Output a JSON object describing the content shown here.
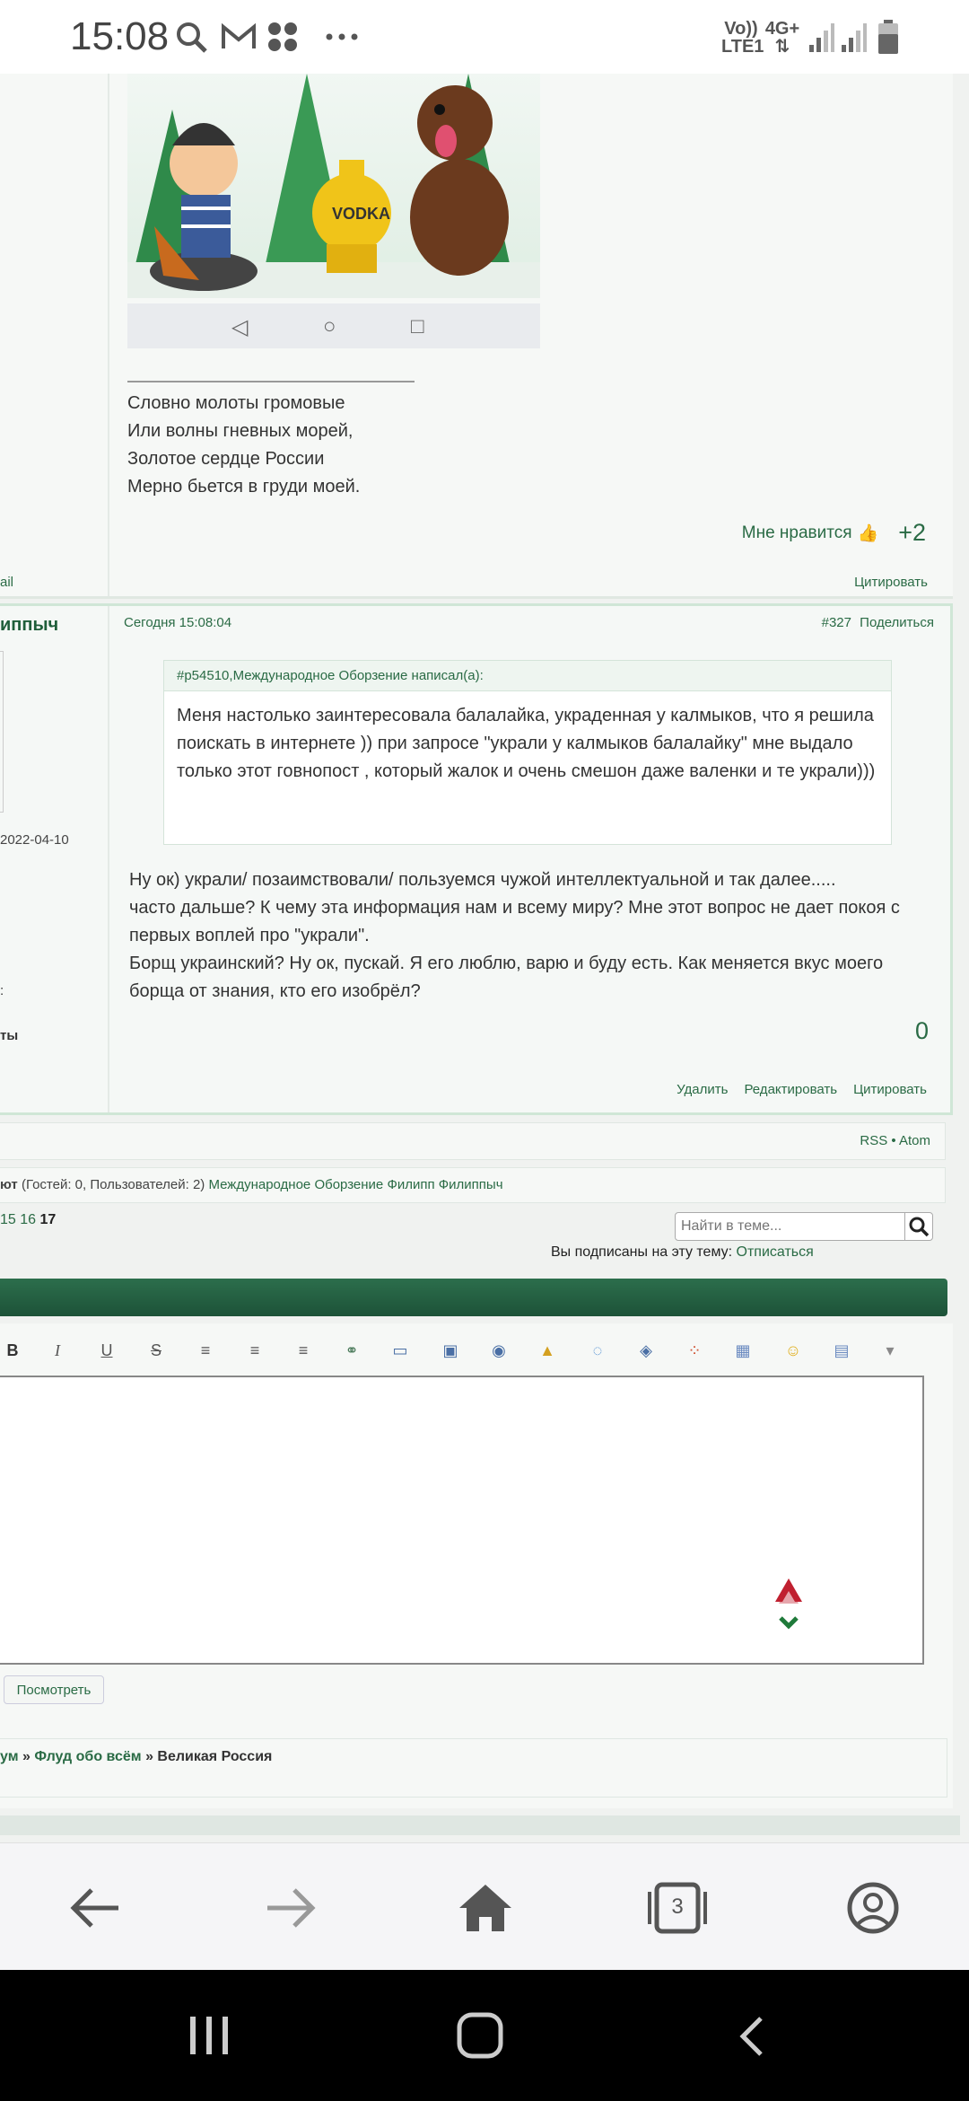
{
  "status_bar": {
    "time": "15:08",
    "volte": "Vo))",
    "lte": "LTE1",
    "network": "4G+"
  },
  "post1": {
    "signature": [
      "Словно молоты громовые",
      "Или волны гневных морей,",
      "Золотое сердце России",
      "Мерно бьется в груди моей."
    ],
    "like_label": "Мне нравится",
    "like_count": "+2",
    "left_link": "ail",
    "quote_link": "Цитировать",
    "meme_text": "VODKA"
  },
  "post2": {
    "author": "иппыч",
    "reg_date": "2022-04-10",
    "side_text_1": ":",
    "side_text_2": "ты",
    "date": "Сегодня 15:08:04",
    "number": "#327",
    "share": "Поделиться",
    "quote_header": "#p54510,Международное Оборзение написал(а):",
    "quote_body": "Меня настолько заинтересовала балалайка, украденная у калмыков, что я решила поискать в интернете )) при запросе \"украли у калмыков балалайку\" мне выдало только этот говнопост , который жалок и очень смешон     даже валенки и те украли)))",
    "text": [
      "Ну ок) украли/ позаимствовали/ пользуемся чужой интеллектуальной и так далее.....",
      "часто дальше? К чему эта информация нам и всему миру? Мне этот вопрос не дает покоя с первых воплей про \"украли\".",
      "Борщ украинский? Ну ок, пускай.  Я его люблю, варю и буду есть. Как меняется вкус моего борща от знания, кто его изобрёл?"
    ],
    "score": "0",
    "actions": [
      "Удалить",
      "Редактировать",
      "Цитировать"
    ]
  },
  "rss": "RSS • Atom",
  "online": {
    "prefix": "ют",
    "counts": "(Гостей: 0, Пользователей: 2)",
    "users": "Международное Оборзение Филипп Филиппыч"
  },
  "pager": {
    "p15": "15",
    "p16": "16",
    "current": "17"
  },
  "search": {
    "placeholder": "Найти в теме..."
  },
  "subscription": {
    "label": "Вы подписаны на эту тему:",
    "link": "Отписаться"
  },
  "preview_button": "Посмотреть",
  "breadcrumb": {
    "part1": "ум",
    "sep": "»",
    "part2": "Флуд обо всём",
    "part3": "Великая Россия"
  },
  "browser_nav": {
    "tabs_count": "3"
  },
  "colors": {
    "accent": "#2a6b45",
    "header_bar": "#1d5238"
  }
}
